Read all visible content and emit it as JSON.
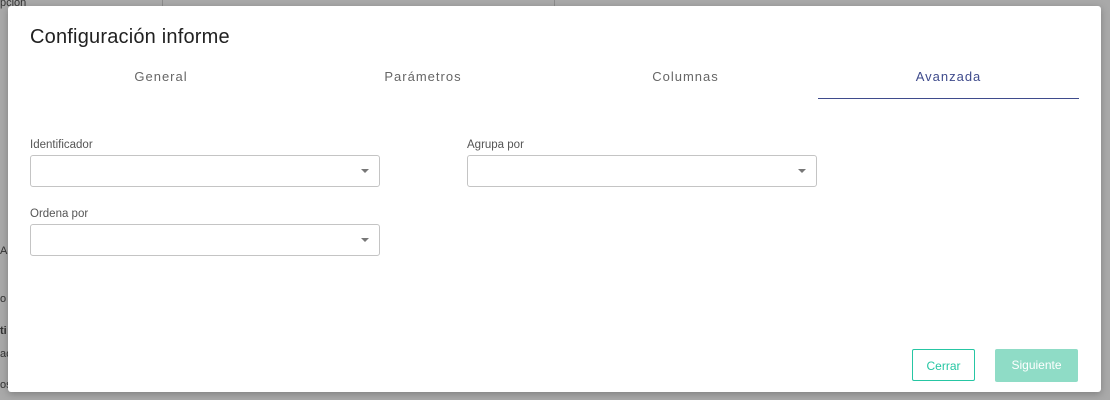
{
  "background": {
    "text_lines": [
      "pción",
      "A",
      "o",
      "ti",
      "ac",
      "os"
    ]
  },
  "modal": {
    "title": "Configuración informe",
    "tabs": [
      {
        "label": "General",
        "active": false
      },
      {
        "label": "Parámetros",
        "active": false
      },
      {
        "label": "Columnas",
        "active": false
      },
      {
        "label": "Avanzada",
        "active": true
      }
    ],
    "fields": {
      "identificador": {
        "label": "Identificador",
        "value": ""
      },
      "agrupa_por": {
        "label": "Agrupa por",
        "value": ""
      },
      "ordena_por": {
        "label": "Ordena por",
        "value": ""
      }
    },
    "buttons": {
      "close_label": "Cerrar",
      "next_label": "Siguiente"
    },
    "colors": {
      "accent_tab": "#3f4b8c",
      "accent_button": "#26c6a3",
      "disabled_button": "#8fdcc6"
    },
    "icons": [
      "chevron-down-icon"
    ]
  }
}
